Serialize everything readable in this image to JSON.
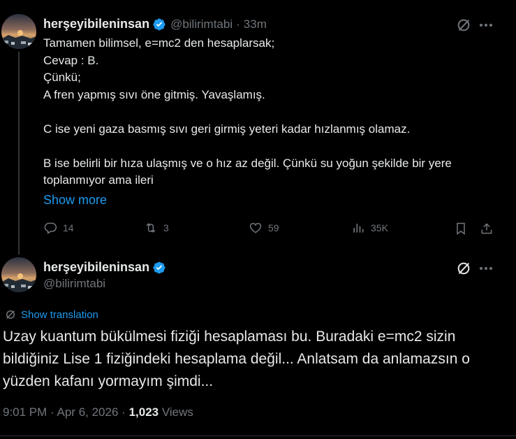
{
  "reply": {
    "display_name": "herşeyibileninsan",
    "handle": "@bilirimtabi",
    "separator": "·",
    "time": "33m",
    "lines": [
      "Tamamen bilimsel, e=mc2 den hesaplarsak;",
      "Cevap : B.",
      "Çünkü;",
      "A fren yapmış sıvı öne gitmiş. Yavaşlamış.",
      "",
      "C ise yeni gaza basmış sıvı geri girmiş yeteri kadar hızlanmış olamaz.",
      "",
      "B ise belirli bir hıza ulaşmış ve o hız az değil. Çünkü su yoğun şekilde bir yere toplanmıyor ama ileri"
    ],
    "show_more": "Show more",
    "actions": {
      "replies": "14",
      "reposts": "3",
      "likes": "59",
      "views": "35K"
    }
  },
  "main": {
    "display_name": "herşeyibileninsan",
    "handle": "@bilirimtabi",
    "show_translation": "Show translation",
    "text": "Uzay kuantum bükülmesi fiziği hesaplaması bu. Buradaki e=mc2 sizin bildiğiniz Lise 1 fiziğindeki hesaplama değil... Anlatsam da anlamazsın o yüzden kafanı yormayım şimdi...",
    "time": "9:01 PM",
    "separator": "·",
    "date": "Apr 6, 2026",
    "separator2": "·",
    "views_count": "1,023",
    "views_label": "Views"
  },
  "colors": {
    "background": "#000000",
    "text": "#e7e9ea",
    "muted": "#71767b",
    "link": "#1d9bf0",
    "verified": "#1d9bf0"
  }
}
